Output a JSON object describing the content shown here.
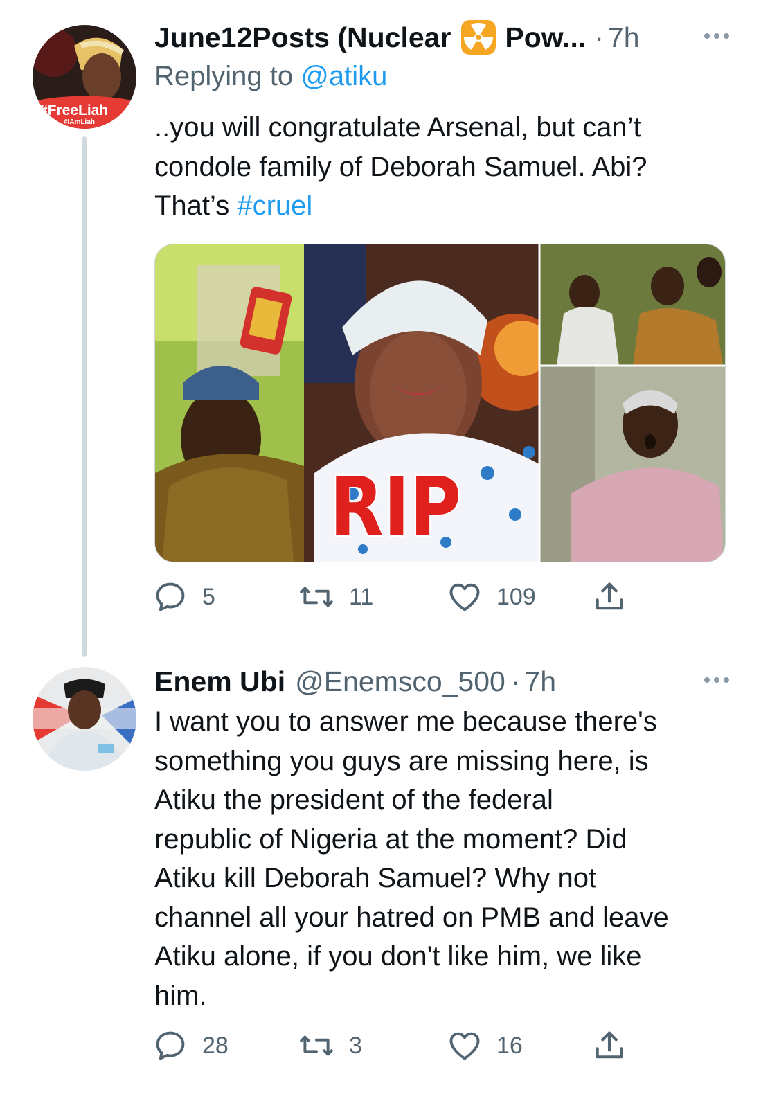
{
  "tweets": [
    {
      "name": "June12Posts (Nuclear",
      "name_emoji_icon": "radioactive-icon",
      "name_suffix": "Pow...",
      "handle": "",
      "dot": "·",
      "time": "7h",
      "replying_prefix": "Replying to",
      "replying_to": "@atiku",
      "avatar_badge_text": "#FreeLiah",
      "avatar_badge_subtext": "#IAmLiah",
      "text_lines": [
        "..you will congratulate Arsenal, but can’t",
        "condole family of Deborah Samuel. Abi?"
      ],
      "text_last_prefix": "That’s ",
      "hashtag": "#cruel",
      "media_overlay_text": "RIP",
      "stats": {
        "replies": "5",
        "retweets": "11",
        "likes": "109"
      }
    },
    {
      "name": "Enem Ubi",
      "handle": "@Enemsco_500",
      "dot": "·",
      "time": "7h",
      "text_lines": [
        "I want you to answer me because there's",
        "something you guys are missing here, is",
        "Atiku the president of the federal",
        "republic of Nigeria at the moment? Did",
        "Atiku kill Deborah Samuel? Why not",
        "channel all your hatred on PMB and leave",
        "Atiku alone, if you don't like him, we like",
        "him."
      ],
      "stats": {
        "replies": "28",
        "retweets": "3",
        "likes": "16"
      }
    }
  ],
  "colors": {
    "text": "#0f1419",
    "secondary": "#536471",
    "link": "#1d9bf0",
    "thread_line": "#cfd9de"
  }
}
